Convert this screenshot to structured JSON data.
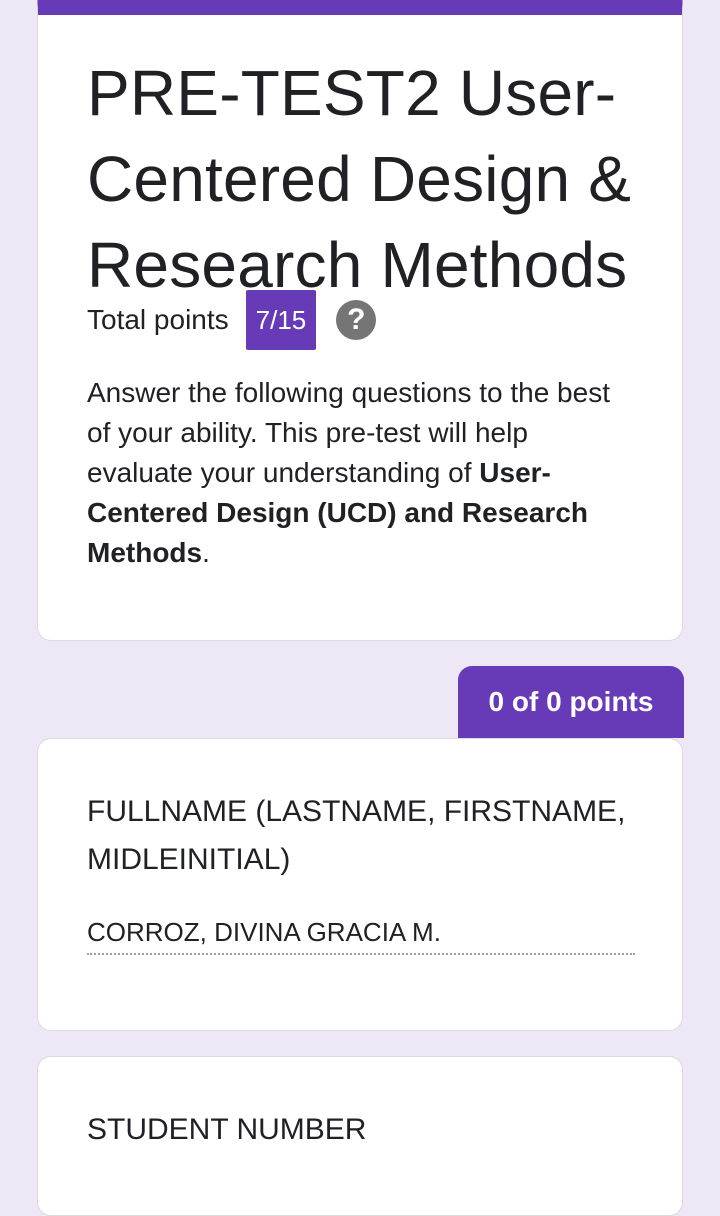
{
  "form": {
    "title": "PRE-TEST2 User-Centered Design & Research Methods",
    "total_points_label": "Total points",
    "score": "7/15",
    "description_plain": " Answer the following questions to the best of your ability. This pre-test will help evaluate your understanding of ",
    "description_bold": "User-Centered Design (UCD) and Research Methods",
    "description_end": ".",
    "accent_color": "#673ab7"
  },
  "section": {
    "points_label": "0 of 0 points"
  },
  "questions": [
    {
      "title": "FULLNAME (LASTNAME, FIRSTNAME, MIDLEINITIAL)",
      "answer": "CORROZ, DIVINA GRACIA M."
    },
    {
      "title": "STUDENT NUMBER",
      "answer": ""
    }
  ],
  "icons": {
    "help": "help-icon"
  }
}
